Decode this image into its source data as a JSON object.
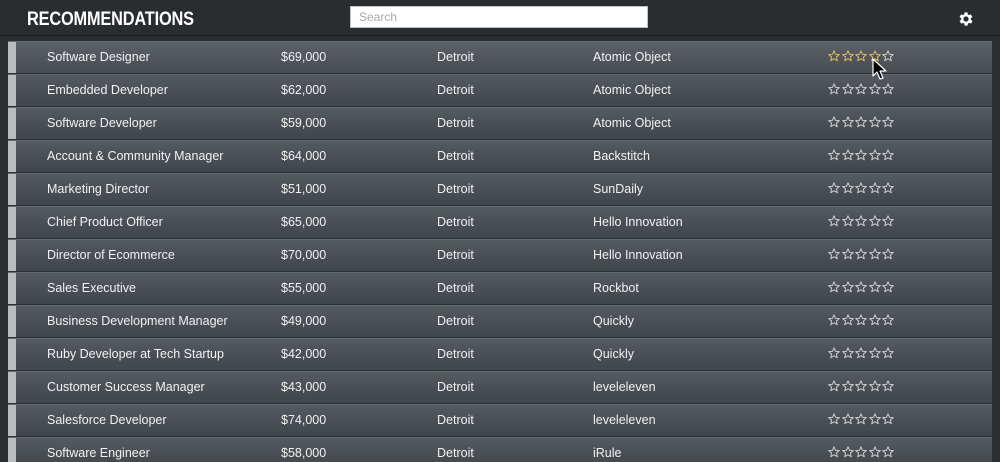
{
  "header": {
    "title": "RECOMMENDATIONS",
    "search_placeholder": "Search",
    "settings_icon": "gear-icon"
  },
  "colors": {
    "star_filled": "#e8c560",
    "star_empty": "#d9d9d9",
    "row_text": "#f2f2f2"
  },
  "rows": [
    {
      "title": "Software Designer",
      "salary": "$69,000",
      "city": "Detroit",
      "company": "Atomic Object",
      "rating": 4
    },
    {
      "title": "Embedded Developer",
      "salary": "$62,000",
      "city": "Detroit",
      "company": "Atomic Object",
      "rating": 0
    },
    {
      "title": "Software Developer",
      "salary": "$59,000",
      "city": "Detroit",
      "company": "Atomic Object",
      "rating": 0
    },
    {
      "title": "Account & Community Manager",
      "salary": "$64,000",
      "city": "Detroit",
      "company": "Backstitch",
      "rating": 0
    },
    {
      "title": "Marketing Director",
      "salary": "$51,000",
      "city": "Detroit",
      "company": "SunDaily",
      "rating": 0
    },
    {
      "title": "Chief Product Officer",
      "salary": "$65,000",
      "city": "Detroit",
      "company": "Hello Innovation",
      "rating": 0
    },
    {
      "title": "Director of Ecommerce",
      "salary": "$70,000",
      "city": "Detroit",
      "company": "Hello Innovation",
      "rating": 0
    },
    {
      "title": "Sales Executive",
      "salary": "$55,000",
      "city": "Detroit",
      "company": "Rockbot",
      "rating": 0
    },
    {
      "title": "Business Development Manager",
      "salary": "$49,000",
      "city": "Detroit",
      "company": "Quickly",
      "rating": 0
    },
    {
      "title": "Ruby Developer at Tech Startup",
      "salary": "$42,000",
      "city": "Detroit",
      "company": "Quickly",
      "rating": 0
    },
    {
      "title": "Customer Success Manager",
      "salary": "$43,000",
      "city": "Detroit",
      "company": "leveleleven",
      "rating": 0
    },
    {
      "title": "Salesforce Developer",
      "salary": "$74,000",
      "city": "Detroit",
      "company": "leveleleven",
      "rating": 0
    },
    {
      "title": "Software Engineer",
      "salary": "$58,000",
      "city": "Detroit",
      "company": "iRule",
      "rating": 0
    }
  ]
}
